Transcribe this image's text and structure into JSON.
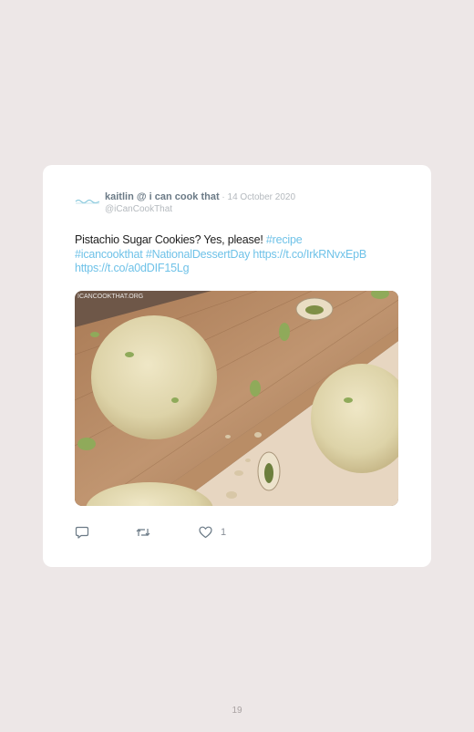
{
  "tweet": {
    "display_name": "kaitlin @ i can cook that",
    "date": "14 October 2020",
    "separator": " · ",
    "handle": "@iCanCookThat",
    "text": {
      "plain": "Pistachio Sugar Cookies? Yes, please! ",
      "hashtag_recipe": "#recipe",
      "hashtag_icancookthat": "#icancookthat",
      "hashtag_dessert": "#NationalDessertDay",
      "link_1": "https://t.co/IrkRNvxEpB",
      "link_2": "https://t.co/a0dDIF15Lg"
    },
    "media": {
      "watermark": "ICANCOOKTHAT.ORG",
      "description_icon": "cookie-photo"
    },
    "actions": {
      "reply_icon": "speech-bubble-icon",
      "retweet_icon": "retweet-icon",
      "like_icon": "heart-icon",
      "like_count": "1"
    }
  },
  "page": {
    "number": "19"
  },
  "colors": {
    "background": "#ede7e7",
    "card": "#ffffff",
    "link": "#6fc2e8",
    "name": "#6b7a86",
    "meta": "#b4b9be"
  }
}
